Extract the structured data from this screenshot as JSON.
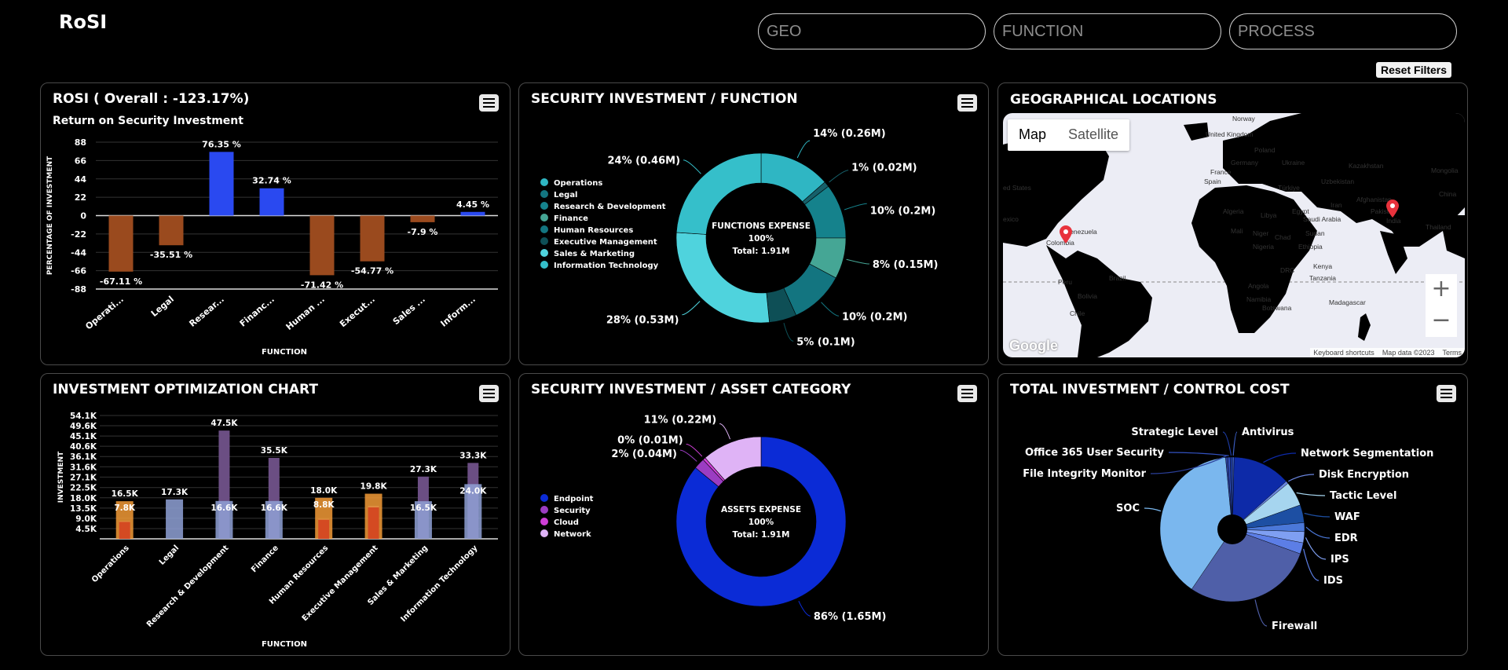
{
  "app_title": "RoSI",
  "filters": {
    "geo": "GEO",
    "function": "FUNCTION",
    "process": "PROCESS",
    "reset": "Reset Filters"
  },
  "colors": {
    "negative": "#9a4a1e",
    "positive": "#2a49f0",
    "bg": "#000000",
    "panel_border": "#4a4a4a"
  },
  "icons": {
    "menu": "hamburger-menu-icon",
    "pin": "map-pin-icon"
  },
  "rosi": {
    "title": "ROSI ( Overall : -123.17%)",
    "chart_data": {
      "type": "bar",
      "title": "Return on Security Investment",
      "xlabel": "FUNCTION",
      "ylabel": "PERCENTAGE OF INVESTMENT",
      "ylim": [
        -88,
        88
      ],
      "yticks": [
        "88",
        "66",
        "44",
        "22",
        "0",
        "-22",
        "-44",
        "-66",
        "-88"
      ],
      "categories": [
        "Operati...",
        "Legal",
        "Resear...",
        "Financ...",
        "Human ...",
        "Execut...",
        "Sales ...",
        "Inform..."
      ],
      "values": [
        -67.11,
        -35.51,
        76.35,
        32.74,
        -71.42,
        -54.77,
        -7.9,
        4.45
      ],
      "labels": [
        "-67.11 %",
        "-35.51 %",
        "76.35 %",
        "32.74 %",
        "-71.42 %",
        "-54.77 %",
        "-7.9 %",
        "4.45 %"
      ],
      "grid": true
    }
  },
  "sec_function": {
    "title": "SECURITY INVESTMENT / FUNCTION",
    "chart_data": {
      "type": "pie",
      "donut": true,
      "center": [
        "FUNCTIONS EXPENSE",
        "100%",
        "Total: 1.91M"
      ],
      "legend_position": "left",
      "legend": [
        "Operations",
        "Legal",
        "Research & Development",
        "Finance",
        "Human Resources",
        "Executive Management",
        "Sales & Marketing",
        "Information Technology"
      ],
      "slices": [
        {
          "value": 0.26,
          "label": "14% (0.26M)",
          "color": "#2fb6c3"
        },
        {
          "value": 0.02,
          "label": "1% (0.02M)",
          "color": "#16606a"
        },
        {
          "value": 0.2,
          "label": "10% (0.2M)",
          "color": "#15828c"
        },
        {
          "value": 0.15,
          "label": "8% (0.15M)",
          "color": "#45a695"
        },
        {
          "value": 0.2,
          "label": "10% (0.2M)",
          "color": "#137580"
        },
        {
          "value": 0.1,
          "label": "5% (0.1M)",
          "color": "#0e4f56"
        },
        {
          "value": 0.53,
          "label": "28% (0.53M)",
          "color": "#4fd3dd"
        },
        {
          "value": 0.46,
          "label": "24% (0.46M)",
          "color": "#35bfca"
        }
      ]
    }
  },
  "geo": {
    "title": "GEOGRAPHICAL LOCATIONS",
    "map_tabs": [
      "Map",
      "Satellite"
    ],
    "zoom_in": "+",
    "zoom_out": "−",
    "brand": "Google",
    "attribution": [
      "Keyboard shortcuts",
      "Map data ©2023",
      "Terms"
    ],
    "places": [
      "Norway",
      "United Kingdom",
      "Poland",
      "Germany",
      "Ukraine",
      "Kazakhstan",
      "Mongolia",
      "France",
      "Spain",
      "Türkiye",
      "ed States",
      "Uzbekistan",
      "Afghanistan",
      "China",
      "Iran",
      "Pakistan",
      "Egypt",
      "Algeria",
      "Libya",
      "Saudi Arabia",
      "India",
      "Thailand",
      "exico",
      "Venezuela",
      "Mali",
      "Niger",
      "Chad",
      "Sudan",
      "Colombia",
      "Nigeria",
      "Ethiopia",
      "Kenya",
      "Peru",
      "DRC",
      "Tanzania",
      "Brazil",
      "Angola",
      "Bolivia",
      "Namibia",
      "Botswana",
      "Madagascar",
      "Chile"
    ]
  },
  "optimization": {
    "title": "INVESTMENT OPTIMIZATION CHART",
    "chart_data": {
      "type": "bar",
      "xlabel": "FUNCTION",
      "ylabel": "INVESTMENT",
      "ylim": [
        0,
        54.1
      ],
      "yticks": [
        "54.1K",
        "49.6K",
        "45.1K",
        "40.6K",
        "36.1K",
        "31.6K",
        "27.1K",
        "22.5K",
        "18.0K",
        "13.5K",
        "9.0K",
        "4.5K"
      ],
      "categories": [
        "Operations",
        "Legal",
        "Research & Development",
        "Finance",
        "Human Resources",
        "Executive Management",
        "Sales & Marketing",
        "Information Technology"
      ],
      "series": [
        {
          "values": [
            16.5,
            17.3,
            16.6,
            16.6,
            18.0,
            19.8,
            16.5,
            24.0
          ],
          "color": "#f29a36"
        },
        {
          "values": [
            7.8,
            null,
            47.5,
            35.5,
            8.8,
            14.5,
            27.3,
            33.3
          ],
          "color": "#6b4e83"
        },
        {
          "values": [
            null,
            null,
            null,
            null,
            null,
            null,
            null,
            null
          ],
          "color": "#8fa1d6"
        }
      ],
      "labels_top": [
        "16.5K",
        "17.3K",
        "47.5K",
        "35.5K",
        "18.0K",
        "19.8K",
        "27.3K",
        "33.3K"
      ],
      "labels_inner": [
        "7.8K",
        "",
        "16.6K",
        "16.6K",
        "8.8K",
        "",
        "16.5K",
        "24.0K"
      ]
    }
  },
  "asset": {
    "title": "SECURITY INVESTMENT / ASSET CATEGORY",
    "chart_data": {
      "type": "pie",
      "donut": true,
      "center": [
        "ASSETS EXPENSE",
        "100%",
        "Total: 1.91M"
      ],
      "legend_position": "left",
      "legend": [
        "Endpoint",
        "Security",
        "Cloud",
        "Network"
      ],
      "slices": [
        {
          "value": 1.65,
          "label": "86% (1.65M)",
          "color": "#0b2bd6"
        },
        {
          "value": 0.04,
          "label": "2% (0.04M)",
          "color": "#9b3dc2"
        },
        {
          "value": 0.01,
          "label": "0% (0.01M)",
          "color": "#cf3fd8"
        },
        {
          "value": 0.22,
          "label": "11% (0.22M)",
          "color": "#dfb3f6"
        }
      ]
    }
  },
  "control": {
    "title": "TOTAL INVESTMENT / CONTROL COST",
    "chart_data": {
      "type": "pie",
      "slices": [
        {
          "label": "Antivirus",
          "value": 0.4,
          "color": "#3b5fc4"
        },
        {
          "label": "Network Segmentation",
          "value": 13,
          "color": "#0d2aa8"
        },
        {
          "label": "Disk Encryption",
          "value": 0.6,
          "color": "#6a86e0"
        },
        {
          "label": "Tactic Level",
          "value": 5.5,
          "color": "#a6d5ef"
        },
        {
          "label": "WAF",
          "value": 4,
          "color": "#1d4fa3"
        },
        {
          "label": "EDR",
          "value": 2,
          "color": "#4b78d9"
        },
        {
          "label": "IPS",
          "value": 2.5,
          "color": "#7f9ff2"
        },
        {
          "label": "IDS",
          "value": 2.5,
          "color": "#5c7ee6"
        },
        {
          "label": "Firewall",
          "value": 29,
          "color": "#4f5fa8"
        },
        {
          "label": "SOC",
          "value": 39,
          "color": "#7ab7ee"
        },
        {
          "label": "File Integrity Monitor",
          "value": 0.5,
          "color": "#2a3f9a"
        },
        {
          "label": "Office 365 User Security",
          "value": 0.5,
          "color": "#3352c1"
        },
        {
          "label": "Strategic Level",
          "value": 0.5,
          "color": "#1c3aa0"
        }
      ]
    }
  }
}
